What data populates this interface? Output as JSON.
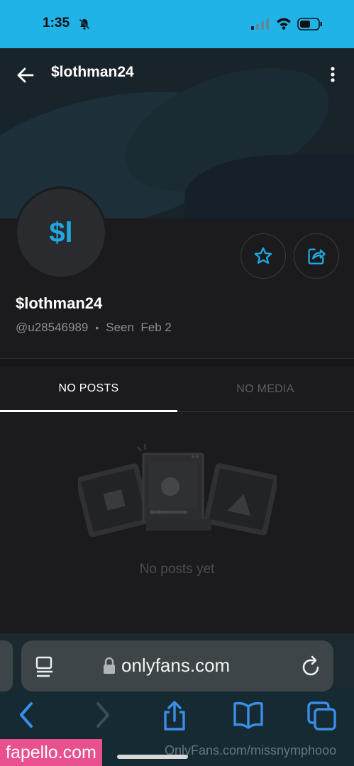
{
  "status_bar": {
    "time": "1:35",
    "icons": [
      "bell-slash-icon",
      "signal-icon",
      "wifi-icon",
      "battery-icon"
    ]
  },
  "header": {
    "title": "$lothman24",
    "back_icon": "arrow-left-icon",
    "more_icon": "more-vertical-icon"
  },
  "profile": {
    "avatar_initials": "$l",
    "display_name": "$lothman24",
    "username": "@u28546989",
    "separator": "•",
    "seen_label": "Seen  Feb 2",
    "actions": [
      "star-icon",
      "share-icon"
    ]
  },
  "tabs": [
    {
      "label": "NO POSTS",
      "active": true
    },
    {
      "label": "NO MEDIA",
      "active": false
    }
  ],
  "empty_state": {
    "message": "No posts yet"
  },
  "browser": {
    "url": "onlyfans.com",
    "toolbar": [
      "back-icon",
      "forward-icon",
      "share-icon",
      "bookmarks-icon",
      "tabs-icon"
    ]
  },
  "watermarks": {
    "badge": "fapello.com",
    "site": "OnlyFans.com/missnymphooo"
  },
  "colors": {
    "accent": "#1fa8e0",
    "status_bar": "#1fb3e8",
    "background": "#1b1b1d",
    "watermark_badge": "#e8508f"
  }
}
